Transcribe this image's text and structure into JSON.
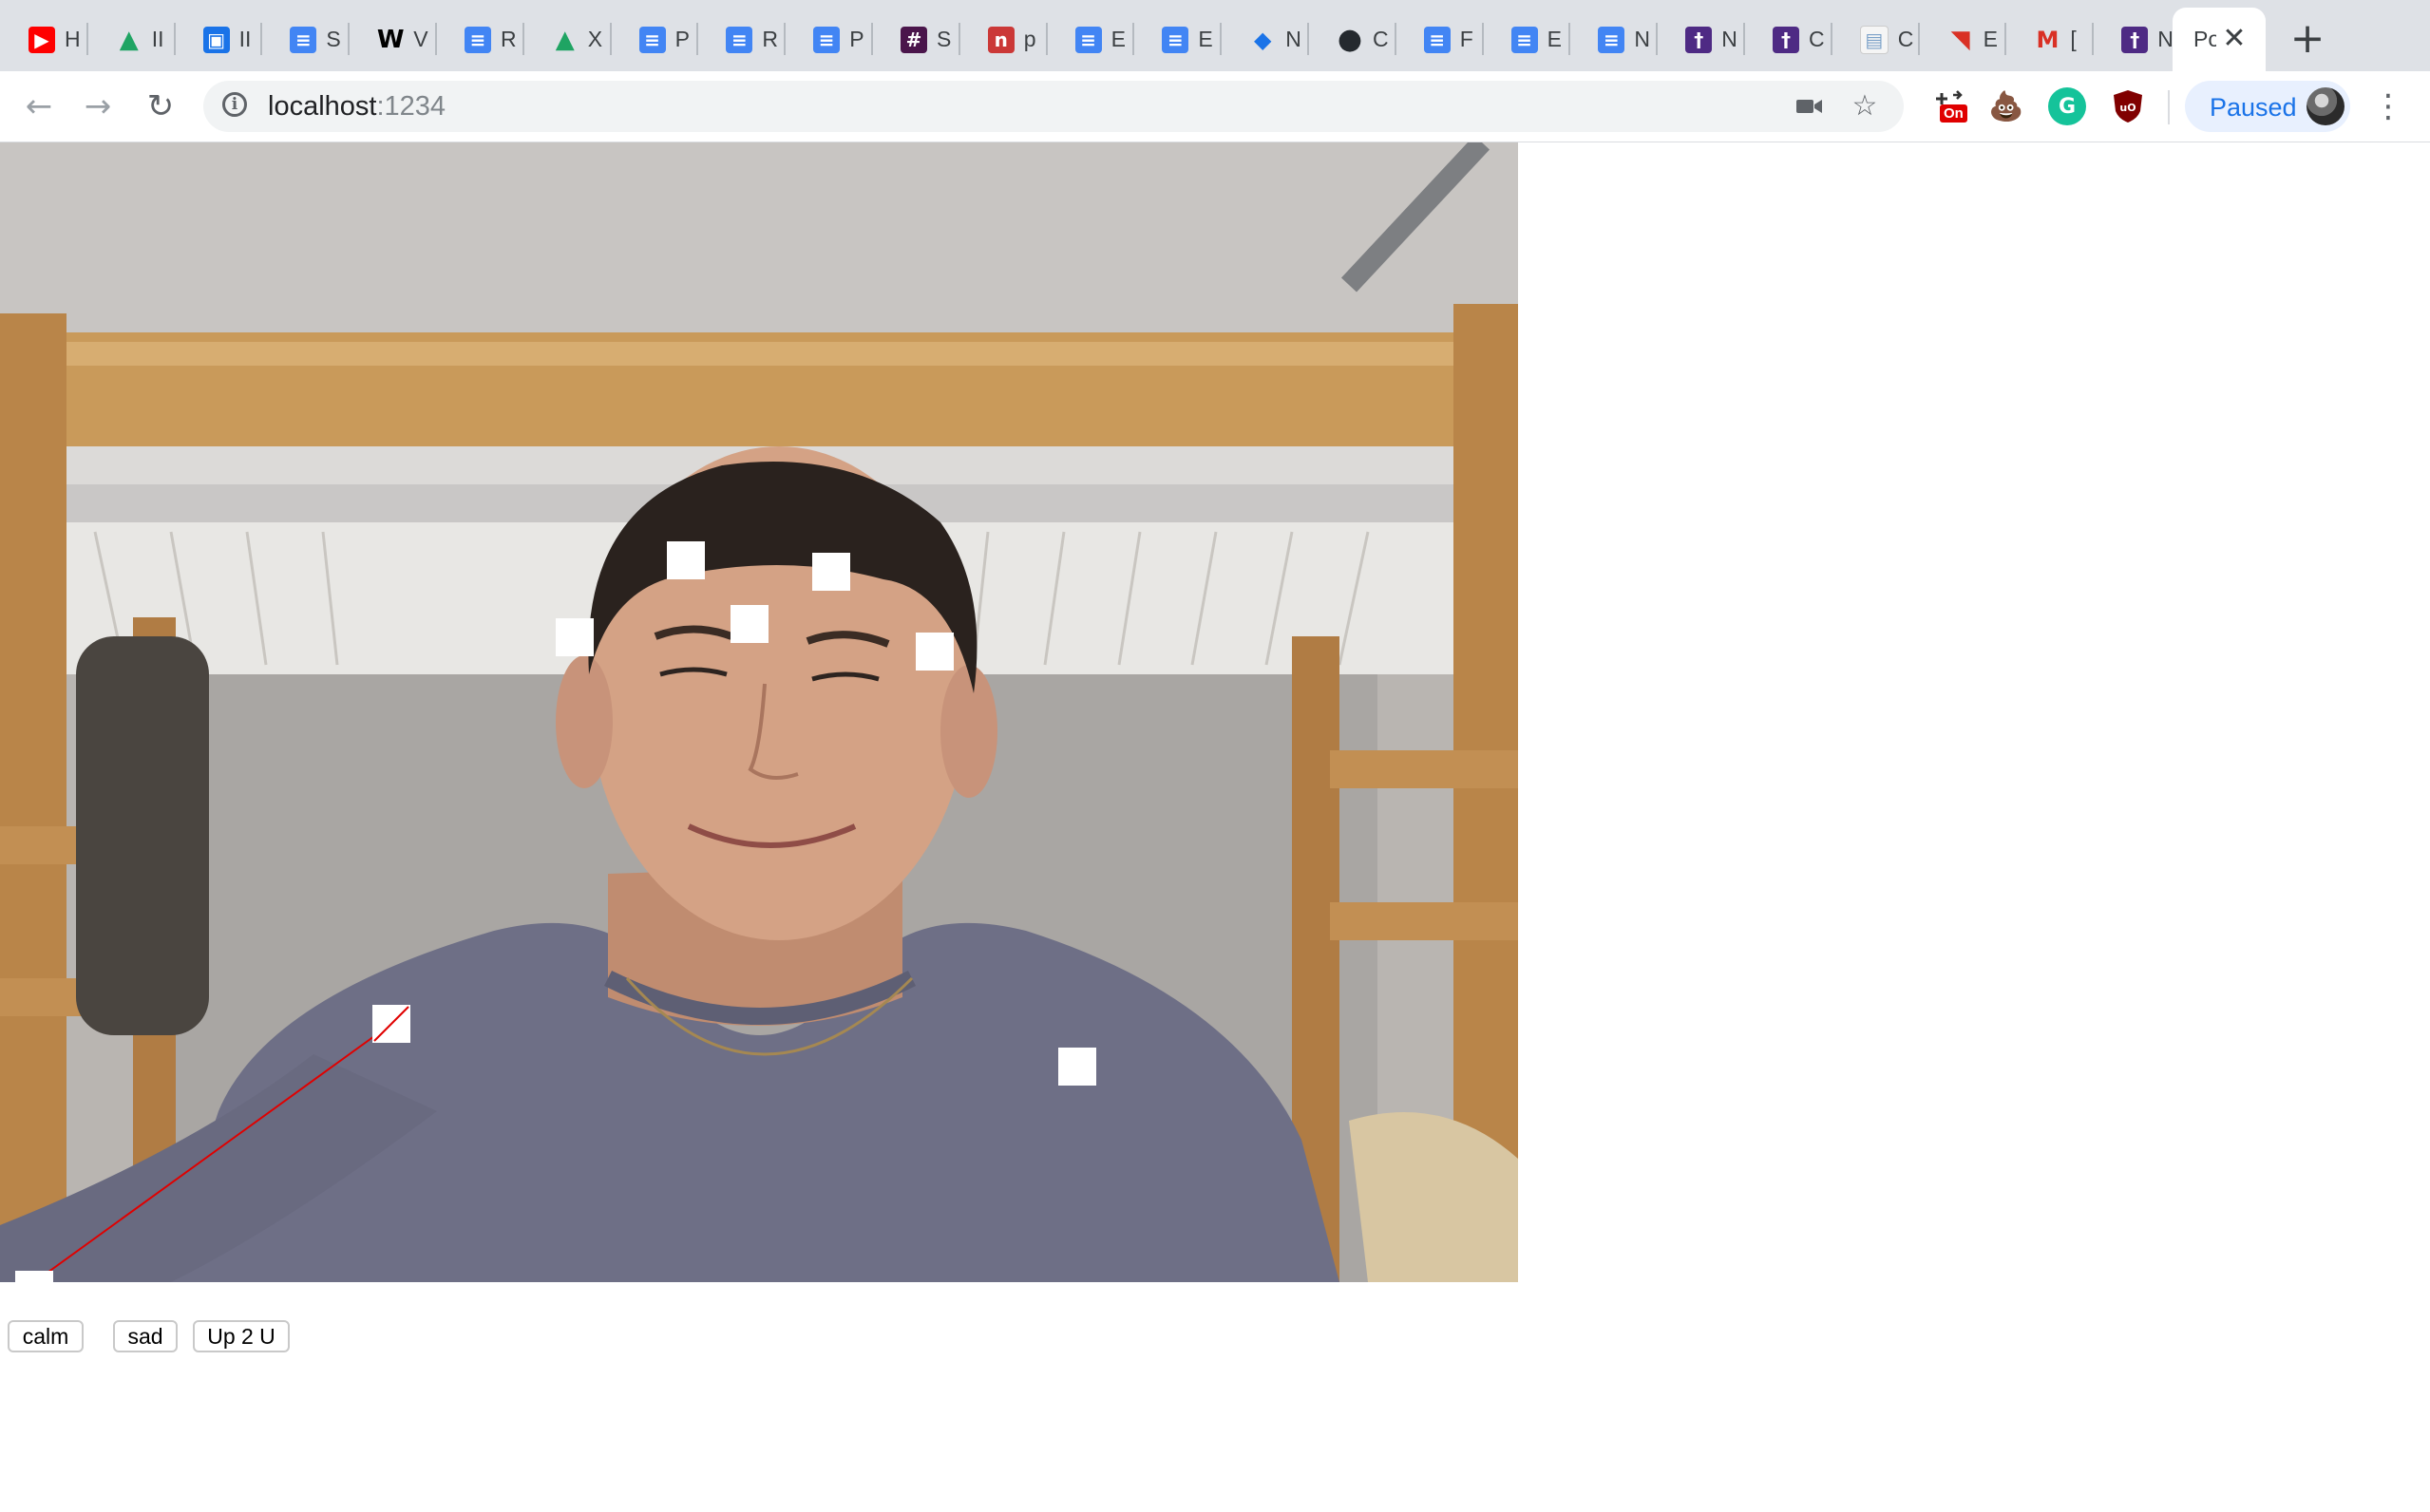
{
  "browser": {
    "tabs": [
      {
        "icon": "youtube-icon",
        "label": "H",
        "color": "#ff0000"
      },
      {
        "icon": "google-drive-icon",
        "label": "II",
        "color": "#1fa463"
      },
      {
        "icon": "tv-icon",
        "label": "II",
        "color": "#1a73e8"
      },
      {
        "icon": "google-docs-icon",
        "label": "S",
        "color": "#4285f4"
      },
      {
        "icon": "wikipedia-icon",
        "label": "V",
        "color": "#000000"
      },
      {
        "icon": "google-docs-icon",
        "label": "R",
        "color": "#4285f4"
      },
      {
        "icon": "google-drive-icon",
        "label": "X",
        "color": "#1fa463"
      },
      {
        "icon": "google-docs-icon",
        "label": "P",
        "color": "#4285f4"
      },
      {
        "icon": "google-docs-icon",
        "label": "R",
        "color": "#4285f4"
      },
      {
        "icon": "google-docs-icon",
        "label": "P",
        "color": "#4285f4"
      },
      {
        "icon": "slack-icon",
        "label": "S",
        "color": "#4a154b"
      },
      {
        "icon": "npm-icon",
        "label": "p",
        "color": "#cb3837"
      },
      {
        "icon": "google-docs-icon",
        "label": "E",
        "color": "#4285f4"
      },
      {
        "icon": "google-docs-icon",
        "label": "E",
        "color": "#4285f4"
      },
      {
        "icon": "stack-icon",
        "label": "N",
        "color": "#1a73e8"
      },
      {
        "icon": "github-icon",
        "label": "C",
        "color": "#24292e"
      },
      {
        "icon": "google-docs-icon",
        "label": "F",
        "color": "#4285f4"
      },
      {
        "icon": "google-docs-icon",
        "label": "E",
        "color": "#4285f4"
      },
      {
        "icon": "google-docs-icon",
        "label": "N",
        "color": "#4285f4"
      },
      {
        "icon": "university-icon",
        "label": "N",
        "color": "#4e2a84"
      },
      {
        "icon": "university-icon",
        "label": "C",
        "color": "#4e2a84"
      },
      {
        "icon": "doc-thumbnail-icon",
        "label": "C",
        "color": "#e0e0e0"
      },
      {
        "icon": "bookmark-red-icon",
        "label": "E",
        "color": "#d93025"
      },
      {
        "icon": "gmail-icon",
        "label": "[",
        "color": "#d93025"
      },
      {
        "icon": "university-icon",
        "label": "N",
        "color": "#4e2a84"
      },
      {
        "icon": "blank-page-icon",
        "label": "Po",
        "color": "#ffffff",
        "active": true
      }
    ],
    "url_host": "localhost",
    "url_port": ":1234",
    "profile_label": "Paused",
    "extension_badge": "On"
  },
  "detection": {
    "keypoints_count": 9,
    "skeleton_line_color": "#e00000",
    "keypoint_color": "#ffffff"
  },
  "controls": {
    "buttons": [
      "calm",
      "sad",
      "Up 2 U"
    ]
  }
}
